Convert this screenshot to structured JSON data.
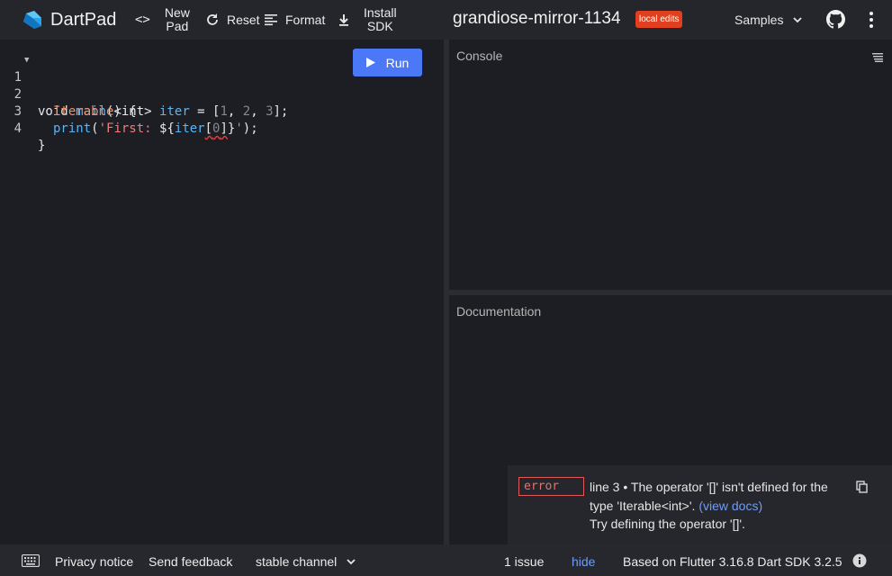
{
  "app": {
    "name": "DartPad"
  },
  "toolbar": {
    "new_pad_line1": "New",
    "new_pad_line2": "Pad",
    "reset_label": "Reset",
    "format_label": "Format",
    "install_line1": "Install",
    "install_line2": "SDK"
  },
  "pad": {
    "title": "grandiose-mirror-1134",
    "badge": "local edits"
  },
  "samples_label": "Samples",
  "editor": {
    "run_label": "Run",
    "line_numbers": [
      "1",
      "2",
      "3",
      "4"
    ],
    "tokens": {
      "l1_void": "void",
      "l1_main": "main",
      "l1_rest": "() {",
      "l2_type": "Iterable",
      "l2_generic": "<int>",
      "l2_var": "iter",
      "l2_eq": " = [",
      "l2_n1": "1",
      "l2_c1": ", ",
      "l2_n2": "2",
      "l2_c2": ", ",
      "l2_n3": "3",
      "l2_end": "];",
      "l3_print": "print",
      "l3_open": "(",
      "l3_str": "'First: ",
      "l3_interp": "${",
      "l3_var": "iter",
      "l3_bracket_open": "[",
      "l3_index": "0",
      "l3_bracket_close": "]",
      "l3_close_interp": "}",
      "l3_strend": "'",
      "l3_end": ");",
      "l4": "}"
    }
  },
  "console": {
    "title": "Console"
  },
  "documentation": {
    "title": "Documentation"
  },
  "issue": {
    "severity": "error",
    "message": "line 3 • The operator '[]' isn't defined for the type 'Iterable<int>'.",
    "link": "(view docs)",
    "fix": "Try defining the operator '[]'."
  },
  "footer": {
    "privacy": "Privacy notice",
    "feedback": "Send feedback",
    "channel": "stable channel",
    "issues": "1 issue",
    "hide": "hide",
    "version": "Based on Flutter 3.16.8 Dart SDK 3.2.5"
  },
  "colors": {
    "accent": "#4a78f6",
    "error": "#e0401f",
    "link": "#6f9cf7"
  }
}
